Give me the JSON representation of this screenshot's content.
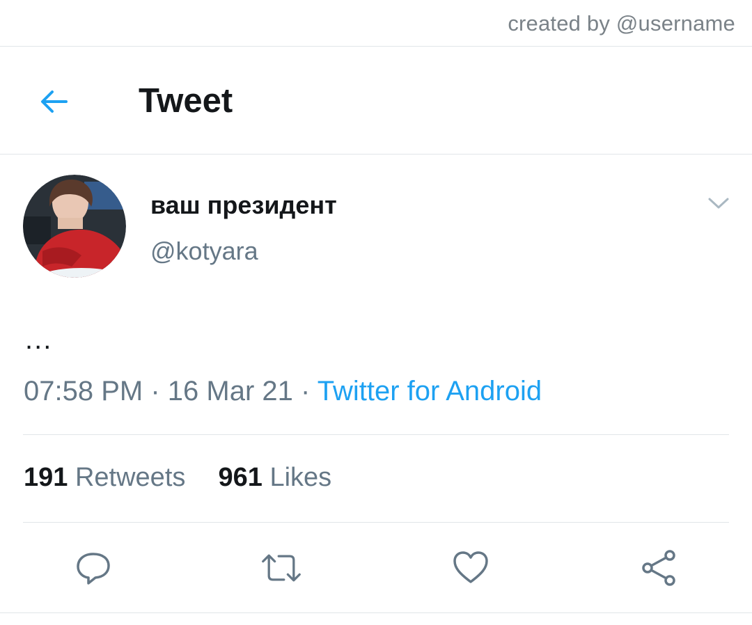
{
  "credit": "created by @username",
  "header": {
    "title": "Tweet",
    "back_icon": "arrow-left-icon"
  },
  "tweet": {
    "display_name": "ваш президент",
    "handle": "@kotyara",
    "text": "...",
    "time": "07:58 PM",
    "date": "16 Mar 21",
    "source": "Twitter for Android",
    "separator": "·",
    "retweets_count": "191",
    "retweets_label": "Retweets",
    "likes_count": "961",
    "likes_label": "Likes"
  },
  "actions": [
    {
      "icon": "reply-icon"
    },
    {
      "icon": "retweet-icon"
    },
    {
      "icon": "like-icon"
    },
    {
      "icon": "share-icon"
    }
  ],
  "colors": {
    "accent": "#1da1f2",
    "secondary_text": "#657786",
    "primary_text": "#14171a",
    "divider": "#e1e5e8",
    "icon": "#657786"
  }
}
